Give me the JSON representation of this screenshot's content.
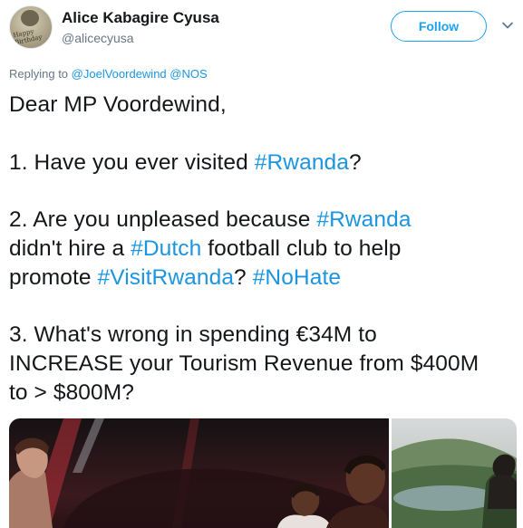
{
  "user": {
    "name": "Alice Kabagire Cyusa",
    "handle": "@alicecyusa"
  },
  "follow_label": "Follow",
  "reply": {
    "prefix": "Replying to",
    "mentions": [
      "@JoelVoordewind",
      "@NOS"
    ]
  },
  "tweet": {
    "greeting": "Dear MP Voordewind,",
    "q1": {
      "before": "1. Have you ever visited ",
      "tag": "#Rwanda",
      "after": "?"
    },
    "q2": {
      "line1_before": "2. Are you unpleased because ",
      "tag1": "#Rwanda",
      "line2_before": "didn't hire a ",
      "tag2": "#Dutch",
      "line2_after": " football club to help",
      "line3_before": "promote ",
      "tag3": "#VisitRwanda",
      "line3_mid": "? ",
      "tag4": "#NoHate"
    },
    "q3": {
      "line1": "3. What's wrong in spending €34M to",
      "line2": "INCREASE your Tourism Revenue from $400M",
      "line3": "to > $800M?"
    }
  },
  "avatar_caption": "Happy Birthday",
  "icons": {
    "more": "chevron-down-icon",
    "avatar": "avatar-image"
  },
  "colors": {
    "link": "#1b95e0",
    "button": "#1da1f2",
    "secondary": "#657786"
  }
}
